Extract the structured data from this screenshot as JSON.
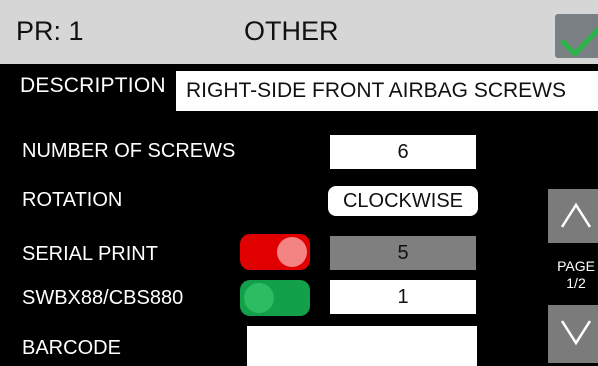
{
  "header": {
    "program": "PR: 1",
    "mode": "OTHER",
    "confirm_icon": "checkmark-icon",
    "colors": {
      "bar": "#d6d6d6",
      "confirm_bg": "#7a7f83",
      "check": "#2bb34a"
    }
  },
  "description": {
    "label": "DESCRIPTION",
    "value": "RIGHT-SIDE FRONT AIRBAG  SCREWS"
  },
  "rows": {
    "screws": {
      "label": "NUMBER OF SCREWS",
      "value": "6"
    },
    "rotation": {
      "label": "ROTATION",
      "value": "CLOCKWISE"
    },
    "serial_print": {
      "label": "SERIAL PRINT",
      "value": "5",
      "enabled": true,
      "toggle_color": "#e00000"
    },
    "swbx": {
      "label": "SWBX88/CBS880",
      "value": "1",
      "enabled": true,
      "toggle_color": "#12a04b"
    },
    "barcode": {
      "label": "BARCODE",
      "value": ""
    }
  },
  "pager": {
    "label": "PAGE",
    "position": "1/2",
    "up_icon": "chevron-up-icon",
    "down_icon": "chevron-down-icon"
  }
}
